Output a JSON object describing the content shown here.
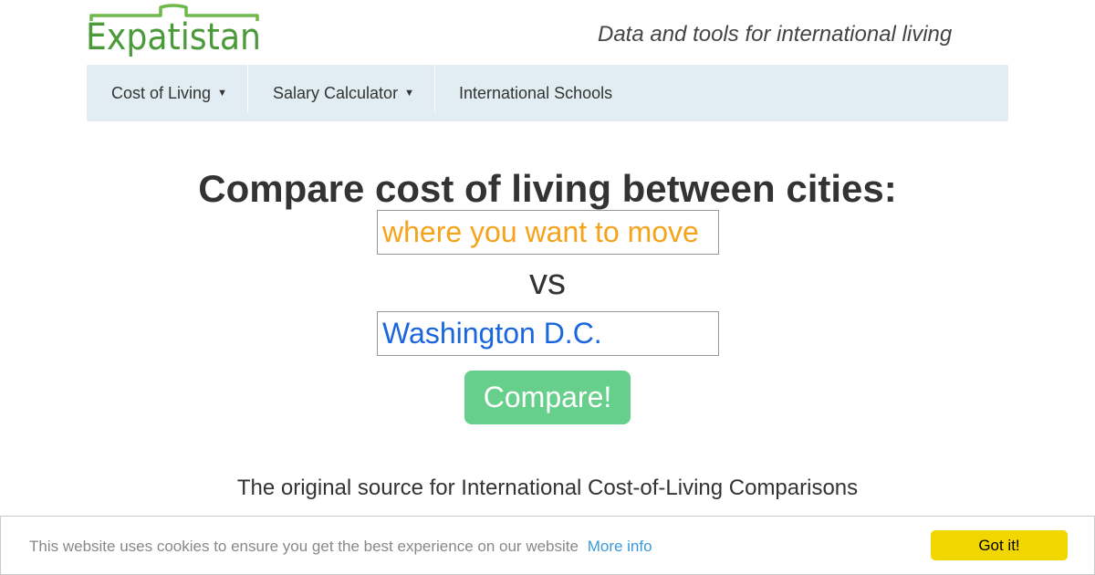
{
  "header": {
    "logo_text": "Expatistan",
    "tagline": "Data and tools for international living"
  },
  "nav": {
    "items": [
      {
        "label": "Cost of Living",
        "has_dropdown": true
      },
      {
        "label": "Salary Calculator",
        "has_dropdown": true
      },
      {
        "label": "International Schools",
        "has_dropdown": false
      }
    ],
    "caret": "▼"
  },
  "main": {
    "headline": "Compare cost of living between cities:",
    "from_city": {
      "value": "",
      "placeholder": "where you want to move"
    },
    "vs_label": "vs",
    "to_city": {
      "value": "Washington D.C.",
      "placeholder": ""
    },
    "compare_label": "Compare!",
    "source_line": "The original source for International Cost-of-Living Comparisons"
  },
  "cookie_banner": {
    "message": "This website uses cookies to ensure you get the best experience on our website",
    "more_info_label": "More info",
    "accept_label": "Got it!"
  },
  "colors": {
    "logo_green": "#4a9a3a",
    "nav_bg": "#e1edf2",
    "placeholder_orange": "#f5a31a",
    "city_blue": "#1a66dd",
    "compare_green": "#66cf8b",
    "cookie_button": "#f1d600",
    "link_blue": "#3a9ad9"
  }
}
